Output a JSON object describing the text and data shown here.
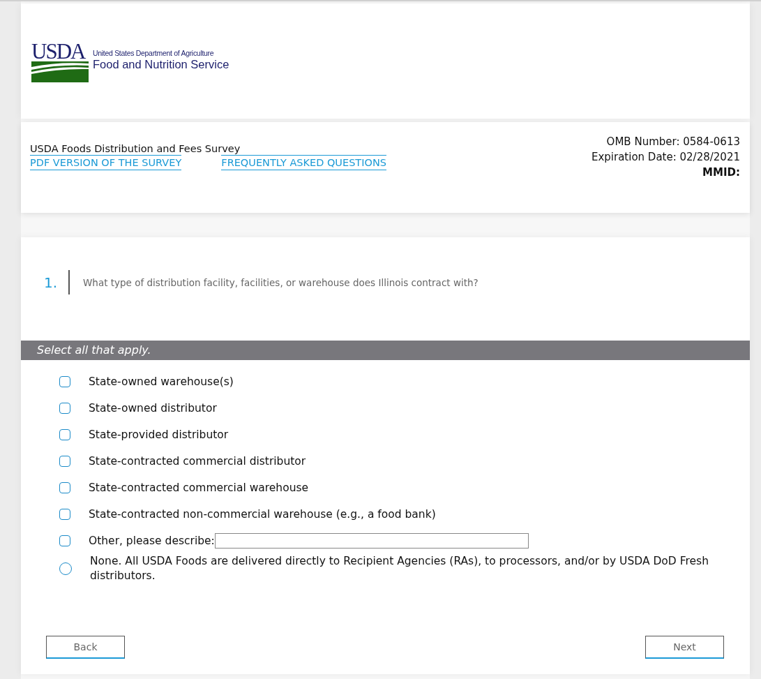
{
  "logo": {
    "mark": "USDA",
    "agency": "United States Department of Agriculture",
    "service": "Food and Nutrition Service"
  },
  "survey": {
    "title": "USDA Foods Distribution and Fees Survey",
    "links": [
      "PDF VERSION OF THE SURVEY",
      "FREQUENTLY ASKED QUESTIONS"
    ],
    "omb": "OMB Number: 0584-0613",
    "expiration": "Expiration Date: 02/28/2021",
    "mmid": "MMID:"
  },
  "question": {
    "number": "1.",
    "text": "What type of distribution facility, facilities, or warehouse does Illinois contract with?",
    "instruction": "Select all that apply.",
    "options": [
      {
        "kind": "checkbox",
        "label": "State-owned warehouse(s)",
        "checked": false
      },
      {
        "kind": "checkbox",
        "label": "State-owned distributor",
        "checked": false
      },
      {
        "kind": "checkbox",
        "label": "State-provided distributor",
        "checked": false
      },
      {
        "kind": "checkbox",
        "label": "State-contracted commercial distributor",
        "checked": false
      },
      {
        "kind": "checkbox",
        "label": "State-contracted commercial warehouse",
        "checked": false
      },
      {
        "kind": "checkbox",
        "label": "State-contracted non-commercial warehouse (e.g., a food bank)",
        "checked": false
      },
      {
        "kind": "checkbox-text",
        "label": "Other, please describe:",
        "checked": false
      },
      {
        "kind": "radio",
        "label": "None. All USDA Foods are delivered directly to Recipient Agencies (RAs), to processors, and/or by USDA DoD Fresh distributors.",
        "checked": false
      }
    ]
  },
  "buttons": [
    "Back",
    "Next"
  ]
}
